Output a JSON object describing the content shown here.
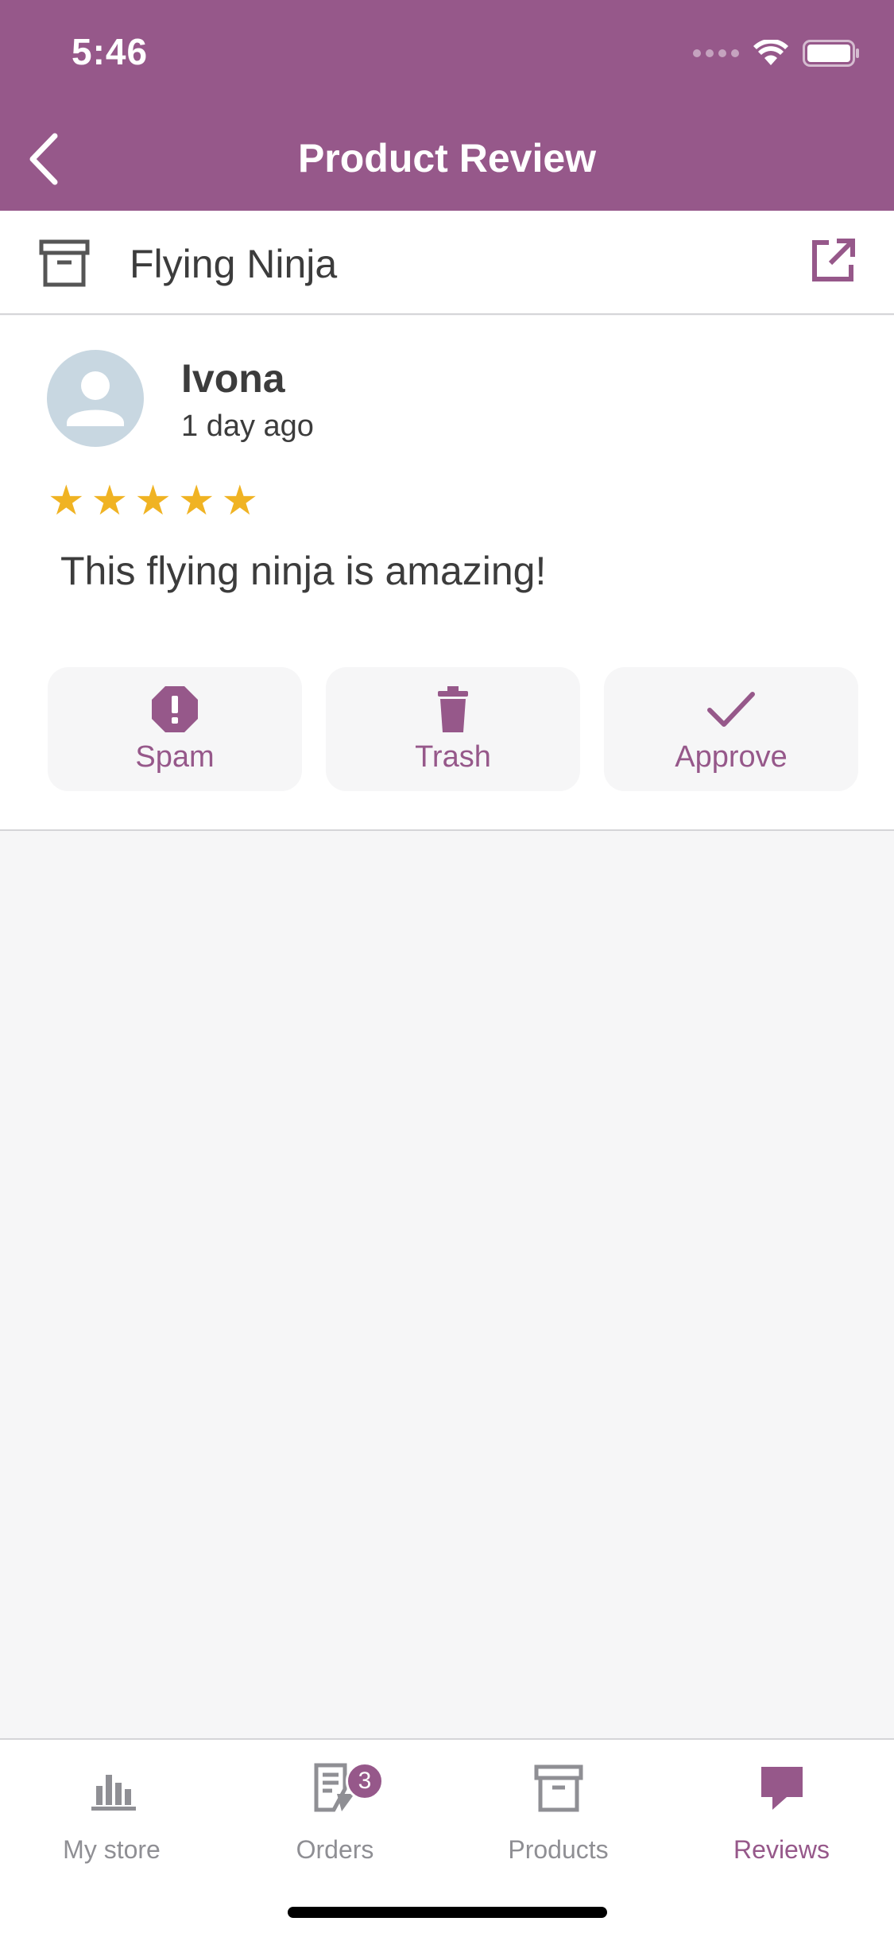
{
  "status_bar": {
    "time": "5:46"
  },
  "header": {
    "title": "Product Review",
    "accent": "#96588a"
  },
  "product": {
    "name": "Flying Ninja"
  },
  "review": {
    "reviewer": "Ivona",
    "time_ago": "1 day ago",
    "rating": 5,
    "text": "This flying ninja is amazing!",
    "star_color": "#f0b323"
  },
  "actions": {
    "spam_label": "Spam",
    "trash_label": "Trash",
    "approve_label": "Approve"
  },
  "tabs": [
    {
      "label": "My store",
      "icon": "chart-bar-icon"
    },
    {
      "label": "Orders",
      "icon": "document-icon",
      "badge": "3"
    },
    {
      "label": "Products",
      "icon": "archive-box-icon"
    },
    {
      "label": "Reviews",
      "icon": "comment-icon",
      "active": true
    }
  ]
}
